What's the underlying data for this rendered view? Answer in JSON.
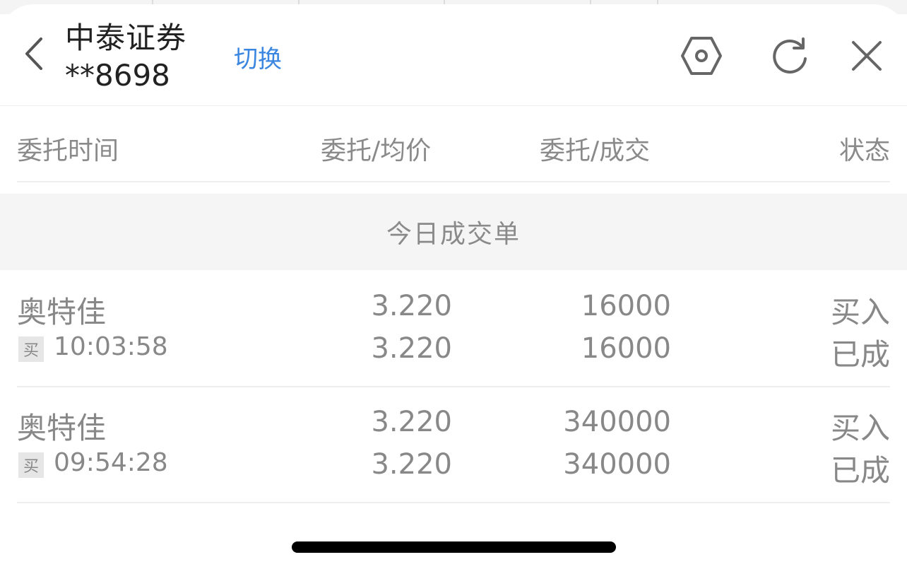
{
  "header": {
    "broker_name": "中泰证券",
    "account_masked": "**8698",
    "switch_label": "切换",
    "icons": {
      "back": "chevron-left-icon",
      "settings": "hexagon-gear-icon",
      "refresh": "refresh-icon",
      "close": "close-icon"
    }
  },
  "columns": {
    "time": "委托时间",
    "price": "委托/均价",
    "qty": "委托/成交",
    "status": "状态"
  },
  "section_title": "今日成交单",
  "orders": [
    {
      "stock": "奥特佳",
      "side_tag": "买",
      "time": "10:03:58",
      "order_price": "3.220",
      "avg_price": "3.220",
      "order_qty": "16000",
      "filled_qty": "16000",
      "action": "买入",
      "state": "已成"
    },
    {
      "stock": "奥特佳",
      "side_tag": "买",
      "time": "09:54:28",
      "order_price": "3.220",
      "avg_price": "3.220",
      "order_qty": "340000",
      "filled_qty": "340000",
      "action": "买入",
      "state": "已成"
    }
  ],
  "colors": {
    "accent": "#3a86e0",
    "muted_text": "#888888",
    "section_bg": "#f5f5f5"
  }
}
